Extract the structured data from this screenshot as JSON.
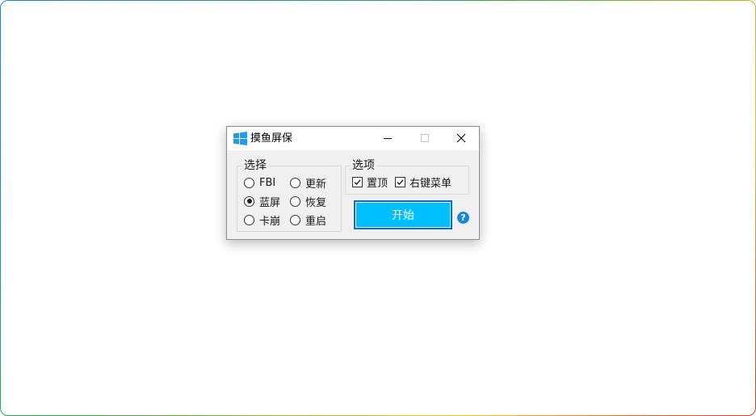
{
  "window": {
    "title": "摸鱼屏保",
    "icon": "windows-logo-icon",
    "controls": [
      "minimize-icon",
      "maximize-icon",
      "close-icon"
    ]
  },
  "select_group": {
    "label": "选择",
    "options": [
      {
        "label": "FBI",
        "selected": false
      },
      {
        "label": "更新",
        "selected": false
      },
      {
        "label": "蓝屏",
        "selected": true
      },
      {
        "label": "恢复",
        "selected": false
      },
      {
        "label": "卡崩",
        "selected": false
      },
      {
        "label": "重启",
        "selected": false
      }
    ]
  },
  "options_group": {
    "label": "选项",
    "checks": [
      {
        "label": "置顶",
        "checked": true
      },
      {
        "label": "右键菜单",
        "checked": true
      }
    ]
  },
  "start_button": {
    "label": "开始"
  },
  "help": {
    "icon": "help-icon",
    "glyph": "?"
  },
  "colors": {
    "accent": "#00bfff",
    "accent_border": "#0a6fbf",
    "help": "#1b87d6",
    "windows_logo": "#1e9bf0"
  }
}
